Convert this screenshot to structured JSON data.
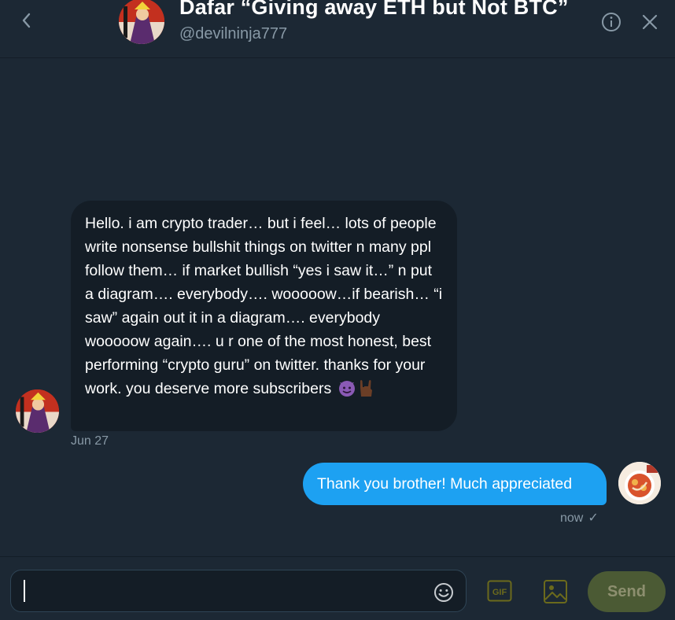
{
  "header": {
    "display_name": "Dafar “Giving away ETH but Not BTC”",
    "handle": "@devilninja777"
  },
  "icons": {
    "back": "chevron-left-icon",
    "info": "info-icon",
    "close": "close-icon",
    "emoji": "emoji-smile-icon",
    "gif": "gif-icon",
    "image": "image-icon"
  },
  "colors": {
    "background": "#1c2834",
    "incoming_bubble": "#141d26",
    "outgoing_bubble": "#1da1f2",
    "muted_text": "#8899a6",
    "send_button": "#4b5a34"
  },
  "messages": [
    {
      "direction": "incoming",
      "text": "Hello. i am crypto trader… but i feel… lots of people write nonsense bullshit things on twitter n many ppl follow them… if market bullish “yes i saw it…” n put a diagram…. everybody…. wooooow…if bearish… “i saw” again out it in a diagram…. everybody wooooow again…. u r one of the most honest, best performing “crypto guru” on twitter. thanks for your work. you deserve more subscribers",
      "emojis": [
        "smiling-devil-emoji",
        "rock-on-hand-emoji"
      ],
      "timestamp": "Jun 27"
    },
    {
      "direction": "outgoing",
      "text": "Thank you brother! Much appreciated",
      "timestamp": "now",
      "status": "✓"
    }
  ],
  "composer": {
    "value": "",
    "send_label": "Send"
  }
}
